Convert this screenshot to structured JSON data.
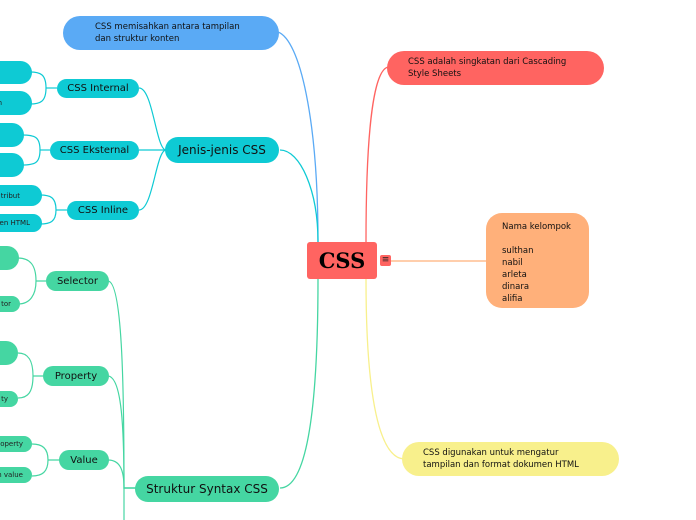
{
  "root": {
    "label": "CSS",
    "menu_icon": "≡"
  },
  "notes": {
    "top_left": "CSS memisahkan antara tampilan dan struktur konten",
    "top_right": "CSS adalah singkatan dari Cascading Style Sheets",
    "group": {
      "title": "Nama kelompok",
      "members": [
        "sulthan",
        "nabil",
        "arleta",
        "dinara",
        "alifia"
      ]
    },
    "bottom_right": "CSS digunakan untuk mengatur tampilan dan format dokumen HTML"
  },
  "branches": {
    "jenis": {
      "label": "Jenis-jenis CSS",
      "children": [
        {
          "label": "CSS Internal",
          "leaves": [
            "",
            "n"
          ]
        },
        {
          "label": "CSS Eksternal",
          "leaves": [
            "",
            ""
          ]
        },
        {
          "label": "CSS Inline",
          "leaves": [
            "tribut",
            "en HTML"
          ]
        }
      ]
    },
    "struktur": {
      "label": "Struktur Syntax CSS",
      "children": [
        {
          "label": "Selector",
          "leaves": [
            "",
            "tor"
          ]
        },
        {
          "label": "Property",
          "leaves": [
            "",
            "ty"
          ]
        },
        {
          "label": "Value",
          "leaves": [
            "operty",
            "n value"
          ]
        }
      ]
    }
  },
  "colors": {
    "root": "#ff6461",
    "blue": "#5aaaf5",
    "red": "#ff6461",
    "teal": "#0ecad4",
    "green": "#45d6a2",
    "orange": "#ffb07a",
    "yellow": "#f8f08c"
  }
}
